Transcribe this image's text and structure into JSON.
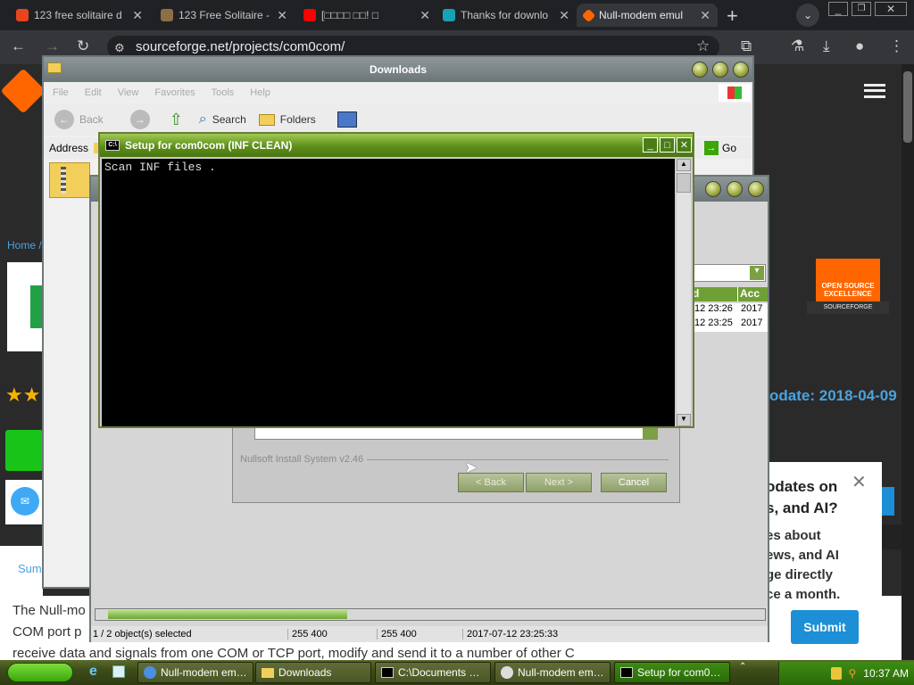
{
  "browser": {
    "tabs": [
      {
        "title": "123 free solitaire d",
        "color": "#e8451e"
      },
      {
        "title": "123 Free Solitaire -",
        "color": "#8d6f45"
      },
      {
        "title": "[□□□□ □□! □",
        "color": "#ff0000"
      },
      {
        "title": "Thanks for downlo",
        "color": "#17a2b8"
      },
      {
        "title": "Null-modem emul",
        "color": "#ff6600"
      }
    ],
    "url": "sourceforge.net/projects/com0com/"
  },
  "sf_page": {
    "breadcrumb": "Home /",
    "badge": [
      "OPEN SOURCE",
      "EXCELLENCE",
      "SOURCEFORGE"
    ],
    "update_label": "odate:",
    "update_value": "2018-04-09",
    "popup_title": "odates on\ns, and AI?",
    "popup_text": "es about\news, and AI\nge directly\nce a month.",
    "submit": "Submit",
    "summary_tab": "Sum",
    "body_text": [
      "The Null-mo",
      "COM port p",
      "receive data and signals from one COM or TCP port, modify and send it to a number of other C"
    ]
  },
  "explorer": {
    "title": "Downloads",
    "menu": [
      "File",
      "Edit",
      "View",
      "Favorites",
      "Tools",
      "Help"
    ],
    "back": "Back",
    "search": "Search",
    "folders": "Folders",
    "address": "Address",
    "go": "Go"
  },
  "explorer2": {
    "columns": [
      "d",
      "Acc"
    ],
    "rows": [
      [
        "12 23:26",
        "2017"
      ],
      [
        "12 23:25",
        "2017"
      ]
    ],
    "status": [
      "1 / 2 object(s) selected",
      "255 400",
      "255 400",
      "2017-07-12 23:25:33"
    ]
  },
  "nsis": {
    "brand": "Nullsoft Install System v2.46",
    "back": "< Back",
    "next": "Next >",
    "cancel": "Cancel"
  },
  "console": {
    "title": "Setup for com0com (INF CLEAN)",
    "text": "Scan INF files ."
  },
  "taskbar": {
    "tasks": [
      "Null-modem em…",
      "Downloads",
      "C:\\Documents …",
      "Null-modem em…",
      "Setup for com0…"
    ],
    "clock": "10:37 AM"
  }
}
